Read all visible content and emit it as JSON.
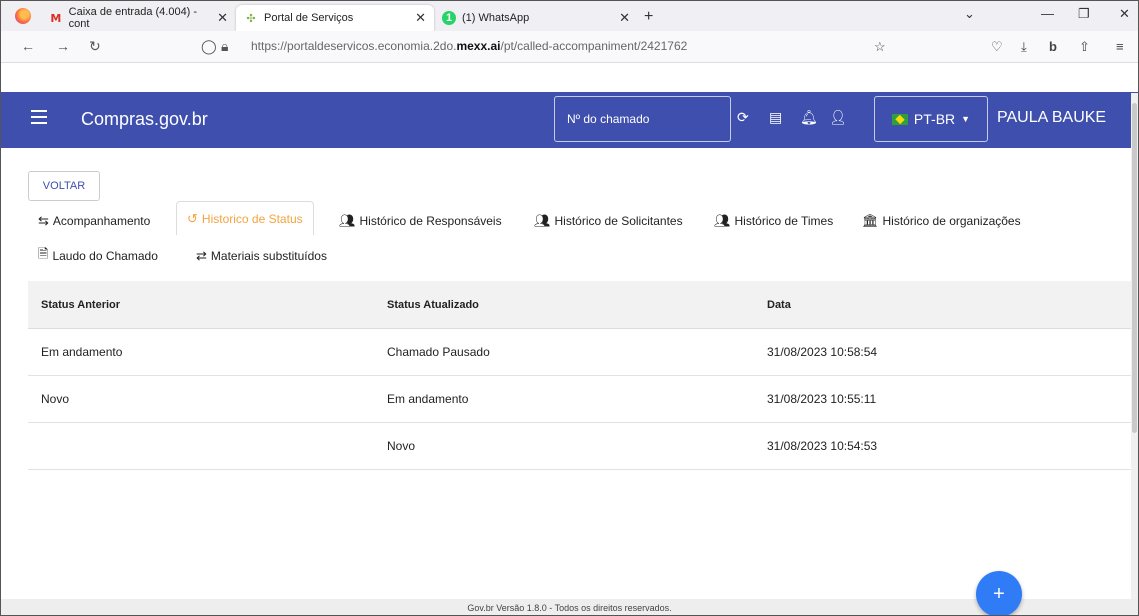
{
  "browser": {
    "tabs": [
      {
        "title": "Caixa de entrada (4.004) - cont",
        "icon": "gmail-icon"
      },
      {
        "title": "Portal de Serviços",
        "icon": "portal-icon"
      },
      {
        "title": "(1) WhatsApp",
        "icon": "whatsapp-icon"
      }
    ],
    "url_prefix": "https://portaldeservicos.economia.2do.",
    "url_domain": "mexx.ai",
    "url_suffix": "/pt/called-accompaniment/2421762"
  },
  "header": {
    "brand": "Compras.gov.br",
    "search_placeholder": "Nº do chamado",
    "language": "PT-BR",
    "user_name": "PAULA BAUKE",
    "color": "#3e4fae"
  },
  "page": {
    "back_label": "VOLTAR",
    "tabs": [
      {
        "label": "Acompanhamento",
        "icon": "accompaniment-icon"
      },
      {
        "label": "Historico de Status",
        "icon": "history-icon",
        "active": true
      },
      {
        "label": "Histórico de Responsáveis",
        "icon": "people-icon"
      },
      {
        "label": "Histórico de Solicitantes",
        "icon": "people-icon"
      },
      {
        "label": "Histórico de Times",
        "icon": "people-icon"
      },
      {
        "label": "Histórico de organizações",
        "icon": "institution-icon"
      },
      {
        "label": "Laudo do Chamado",
        "icon": "document-icon"
      },
      {
        "label": "Materiais substituídos",
        "icon": "swap-icon"
      }
    ],
    "active_tab_color": "#f4a341"
  },
  "table": {
    "headers": [
      "Status Anterior",
      "Status Atualizado",
      "Data"
    ],
    "rows": [
      [
        "Em andamento",
        "Chamado Pausado",
        "31/08/2023 10:58:54"
      ],
      [
        "Novo",
        "Em andamento",
        "31/08/2023 10:55:11"
      ],
      [
        "",
        "Novo",
        "31/08/2023 10:54:53"
      ]
    ]
  },
  "footer": {
    "text": "Gov.br Versão 1.8.0 - Todos os direitos reservados."
  },
  "fab_label": "+"
}
